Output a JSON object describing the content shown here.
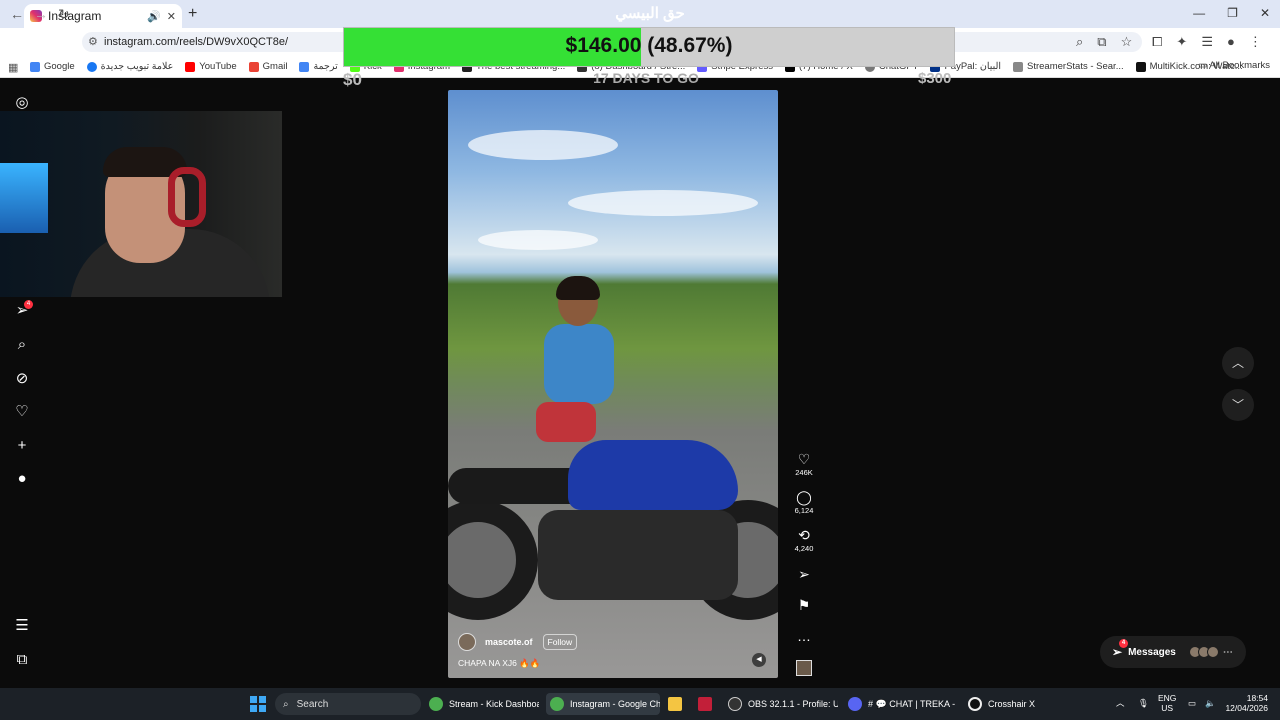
{
  "browser": {
    "tab_title": "Instagram",
    "url": "instagram.com/reels/DW9vX0QCT8e/",
    "bookmarks": [
      "Google",
      "علامة تبويب جديدة",
      "YouTube",
      "Gmail",
      "ترجمة",
      "Kick",
      "Instagram",
      "The best streaming...",
      "(8) Dashboard / Stre...",
      "Stripe Express",
      "(7) Home / X",
      "ChatGPT",
      "PayPal: البيان",
      "StreamerStats - Sear...",
      "MultiKick.com: Watc..."
    ],
    "all_bookmarks": "All Bookmarks"
  },
  "overlay": {
    "title": "حق البيسي",
    "goal_text": "$146.00 (48.67%)",
    "progress_fraction": 0.4867,
    "start_amount": "$0",
    "days_left": "17 DAYS TO GO",
    "target_amount": "$300",
    "bar_color": "#35e035"
  },
  "reel": {
    "username": "mascote.of",
    "follow_label": "Follow",
    "caption": "CHAPA NA XJ6 🔥🔥",
    "likes": "246K",
    "comments": "6,124",
    "reposts": "4,240"
  },
  "sidebar": {
    "notifications_badge": "4"
  },
  "messages": {
    "label": "Messages",
    "badge": "4"
  },
  "taskbar": {
    "search_label": "Search",
    "items": [
      "Stream - Kick Dashboard",
      "Instagram - Google Chr",
      "OBS 32.1.1 - Profile: Unti",
      "# 💬 CHAT | TREKA - Di",
      "Crosshair X"
    ],
    "lang_top": "ENG",
    "lang_bottom": "US",
    "time": "18:54",
    "date": "12/04/2026"
  }
}
